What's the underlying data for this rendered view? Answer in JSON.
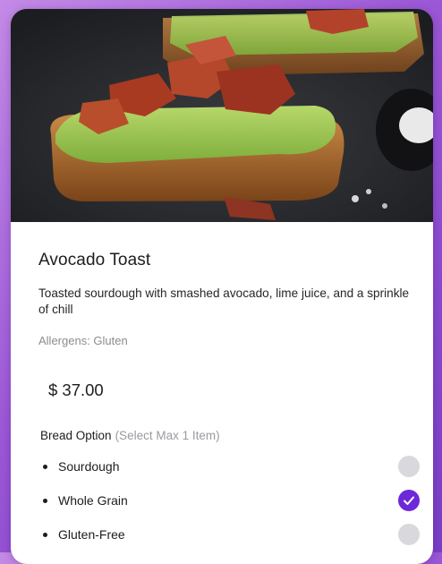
{
  "item": {
    "name": "Avocado Toast",
    "description": "Toasted sourdough with smashed avocado, lime juice, and a sprinkle of chill",
    "allergens": "Allergens: Gluten",
    "price": "$ 37.00"
  },
  "options": {
    "header": "Bread Option",
    "hint": "(Select Max 1 Item)",
    "items": [
      {
        "label": "Sourdough",
        "selected": false
      },
      {
        "label": "Whole Grain",
        "selected": true
      },
      {
        "label": "Gluten-Free",
        "selected": false
      }
    ]
  },
  "colors": {
    "accent": "#6d28d9",
    "unselected": "#d9d9dd",
    "background": "#9a56d6"
  },
  "icons": {
    "hero": "avocado-toast-photo",
    "check": "check-icon"
  }
}
